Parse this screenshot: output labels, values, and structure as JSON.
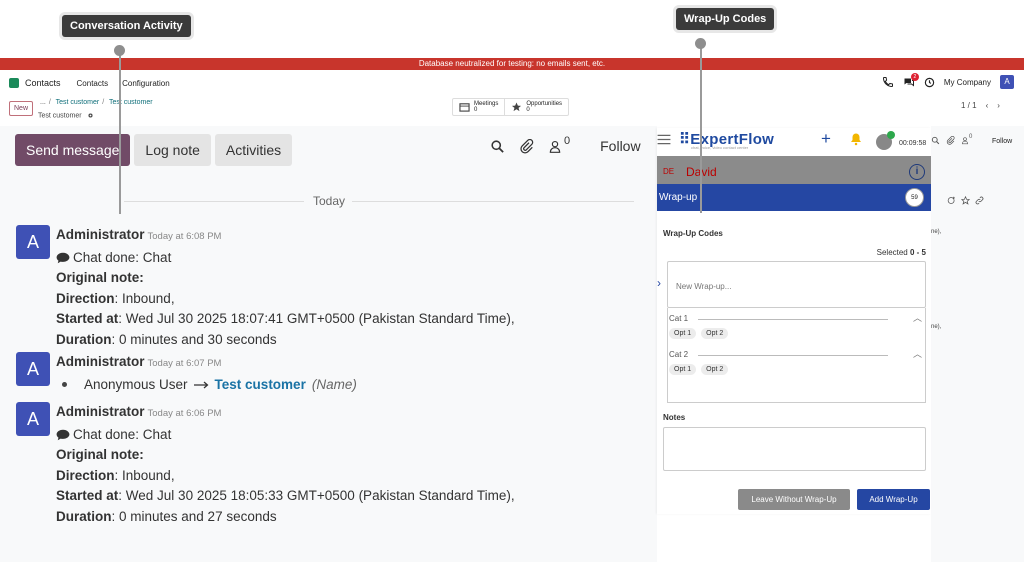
{
  "callouts": {
    "conversation_activity": "Conversation Activity",
    "wrapup_codes": "Wrap-Up Codes"
  },
  "banner": "Database neutralized for testing: no emails sent, etc.",
  "topnav": {
    "app_name": "Contacts",
    "links": [
      "Contacts",
      "Configuration"
    ],
    "chat_badge": "2",
    "company": "My Company",
    "user_initial": "A"
  },
  "control": {
    "new_label": "New",
    "breadcrumb": [
      "...",
      "Test customer",
      "Test customer"
    ],
    "record_name": "Test customer",
    "smart_buttons": [
      {
        "label": "Meetings",
        "count": "0"
      },
      {
        "label": "Opportunities",
        "count": "0"
      }
    ],
    "pager": "1 / 1"
  },
  "chatter": {
    "send_message": "Send message",
    "log_note": "Log note",
    "activities": "Activities",
    "follower_count": "0",
    "follow": "Follow",
    "day": "Today",
    "messages": [
      {
        "initial": "A",
        "author": "Administrator",
        "time": "Today at 6:08 PM",
        "chat_done": "Chat done: Chat",
        "original_note_label": "Original note:",
        "direction_label": "Direction",
        "direction": ": Inbound,",
        "started_label": "Started at",
        "started": ": Wed Jul 30 2025 18:07:41 GMT+0500 (Pakistan Standard Time),",
        "duration_label": "Duration",
        "duration": ": 0 minutes and 30 seconds"
      },
      {
        "initial": "A",
        "author": "Administrator",
        "time": "Today at 6:07 PM",
        "old_value": "Anonymous User",
        "new_value": "Test customer",
        "field": "(Name)"
      },
      {
        "initial": "A",
        "author": "Administrator",
        "time": "Today at 6:06 PM",
        "chat_done": "Chat done: Chat",
        "original_note_label": "Original note:",
        "direction_label": "Direction",
        "direction": ": Inbound,",
        "started_label": "Started at",
        "started": ": Wed Jul 30 2025 18:05:33 GMT+0500 (Pakistan Standard Time),",
        "duration_label": "Duration",
        "duration": ": 0 minutes and 27 seconds"
      }
    ]
  },
  "right_strip": {
    "follower_count": "0",
    "follow": "Follow",
    "frag1": "ne),",
    "frag2": "ne),"
  },
  "expertflow": {
    "logo": "ExpertFlow",
    "tagline": "chat, voice, video contact center",
    "timer": "00:09:58",
    "contact_initials": "DE",
    "contact_name": "David",
    "wrapup_title": "Wrap-up",
    "wrapup_timer": "59",
    "codes_title": "Wrap-Up Codes",
    "selected_prefix": "Selected ",
    "selected_count": "0 - 5",
    "input_placeholder": "New Wrap-up...",
    "categories": [
      {
        "name": "Cat 1",
        "options": [
          "Opt 1",
          "Opt 2"
        ]
      },
      {
        "name": "Cat 2",
        "options": [
          "Opt 1",
          "Opt 2"
        ]
      }
    ],
    "notes_title": "Notes",
    "leave_button": "Leave Without Wrap-Up",
    "add_button": "Add Wrap-Up"
  }
}
